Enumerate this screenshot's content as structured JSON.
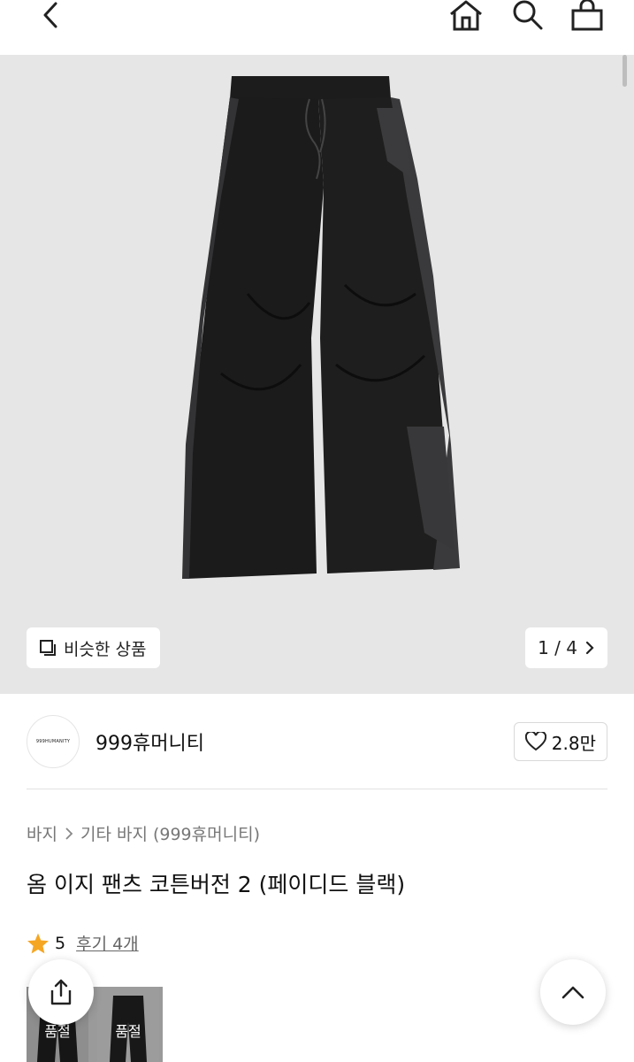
{
  "header": {
    "back_icon": "chevron-left-icon",
    "home_icon": "home-icon",
    "search_icon": "search-icon",
    "cart_icon": "shopping-bag-icon"
  },
  "gallery": {
    "similar_label": "비슷한 상품",
    "page_indicator": "1 / 4",
    "background": "#e6e6e6"
  },
  "seller": {
    "logo_text": "999HUMANITY",
    "name": "999휴머니티",
    "likes": "2.8만"
  },
  "product": {
    "breadcrumb": [
      "바지",
      "기타 바지 (999휴머니티)"
    ],
    "title": "옴 이지 팬츠 코튼버전 2 (페이디드 블랙)",
    "rating": "5",
    "reviews_label": "후기 4개",
    "star_color": "#f5a623"
  },
  "thumbnails": [
    {
      "label": "품절"
    },
    {
      "label": "품절"
    }
  ]
}
